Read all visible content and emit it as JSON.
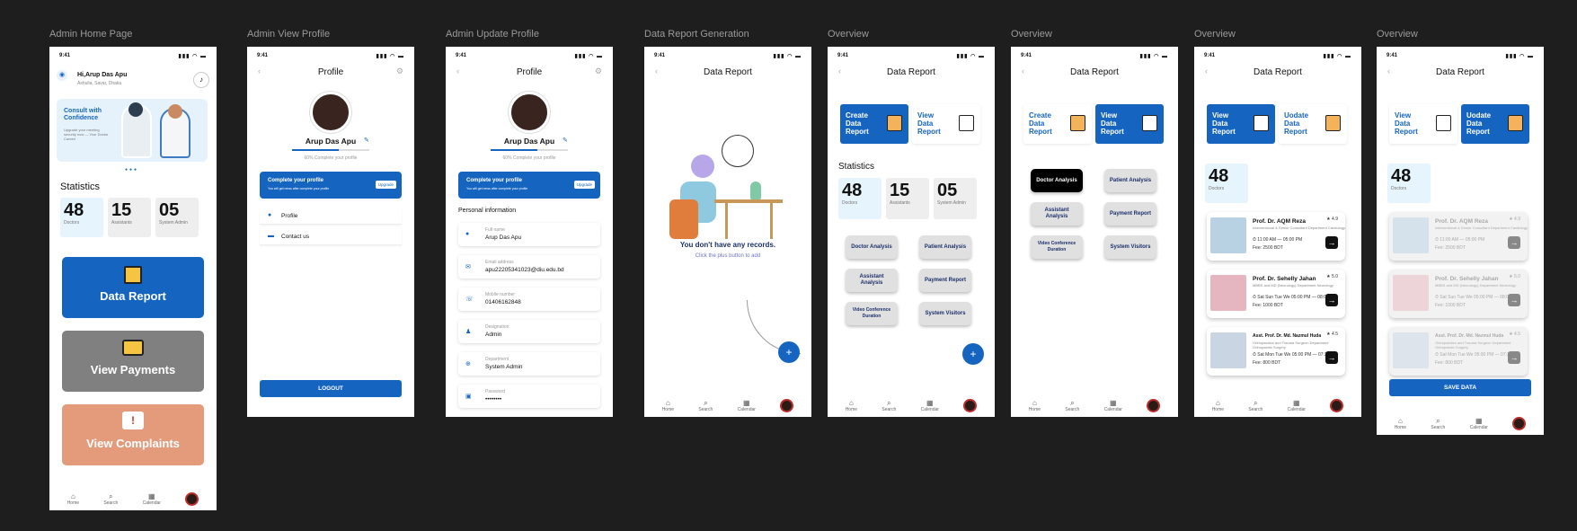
{
  "frames": [
    {
      "label": "Admin Home Page"
    },
    {
      "label": "Admin View Profile"
    },
    {
      "label": "Admin Update Profile"
    },
    {
      "label": "Data Report Generation"
    },
    {
      "label": "Overview"
    },
    {
      "label": "Overview"
    },
    {
      "label": "Overview"
    },
    {
      "label": "Overview"
    }
  ],
  "status_time": "9:41",
  "status_icons": "▮▮▮ ◠ ▬",
  "nav": {
    "home": "Home",
    "search": "Search",
    "calendar": "Calendar",
    "home_icon": "⌂",
    "search_icon": "⌕",
    "calendar_icon": "▦"
  },
  "home": {
    "greeting": "Hi,Arup Das Apu",
    "location": "Ashulia, Savar, Dhaka",
    "banner_title": "Consult with Confidence",
    "banner_text": "Upgrade your meeting security now — Your Doctor Career!",
    "statistics": "Statistics",
    "stats": [
      {
        "n": "48",
        "l": "Doctors"
      },
      {
        "n": "15",
        "l": "Assistants"
      },
      {
        "n": "05",
        "l": "System Admin"
      }
    ],
    "data_report": "Data Report",
    "view_payments": "View Payments",
    "view_complaints": "View Complaints"
  },
  "profile": {
    "title": "Profile",
    "name": "Arup Das Apu",
    "progress": 0.6,
    "progress_text": "60% Complete your profile",
    "complete_title": "Complete your profile",
    "complete_sub": "You will get news after complete your profile",
    "upgrade": "Upgrade",
    "menu_profile": "Profile",
    "menu_contact": "Contact us",
    "logout": "LOGOUT"
  },
  "update": {
    "section": "Personal information",
    "fields": [
      {
        "label": "Full name",
        "value": "Arup Das Apu"
      },
      {
        "label": "Email address",
        "value": "apu2220534102​3@diu.edu.bd"
      },
      {
        "label": "Mobile number",
        "value": "01406162848"
      },
      {
        "label": "Designation",
        "value": "Admin"
      },
      {
        "label": "Department",
        "value": "System Admin"
      },
      {
        "label": "Password",
        "value": "••••••••"
      }
    ]
  },
  "report": {
    "title": "Data Report",
    "empty_title": "You don't have any records.",
    "empty_sub": "Click the plus button to add",
    "create": "Create Data Report",
    "view": "View Data Report",
    "update": "Uodate Data Report",
    "statistics": "Statistics",
    "stats": [
      {
        "n": "48",
        "l": "Doctors"
      },
      {
        "n": "15",
        "l": "Assistants"
      },
      {
        "n": "05",
        "l": "System Admin"
      }
    ],
    "analysis": [
      "Doctor Analysis",
      "Patient Analysis",
      "Assistant Analysis",
      "Payment Report",
      "Video Conference Duration",
      "System Visitors"
    ],
    "save": "SAVE DATA"
  },
  "doctors": [
    {
      "name": "Prof. Dr. AQM Reza",
      "spec": "Interventional & Senior Consultant Department Cardiology",
      "time": "⏱ 11:00 AM — 05:00 PM",
      "fee": "Fee: 2500 BDT",
      "rating": "★ 4.9"
    },
    {
      "name": "Prof. Dr. Sehelly Jahan",
      "spec": "MBBS and MD (Neurology) Department Neurology",
      "time": "⏱ Sat Sun Tue We 05:00 PM — 08:00 PM",
      "fee": "Fee: 1000 BDT",
      "rating": "★ 5.0"
    },
    {
      "name": "Asst. Prof. Dr. Md. Nazmul Huda",
      "spec": "Orthopaedics and Trauma Surgeon Department Orthopaedic Surgery",
      "time": "⏱ Sat Mon Tue We 05:00 PM — 07:30 PM",
      "fee": "Fee: 800 BDT",
      "rating": "★ 4.5"
    }
  ],
  "colors": {
    "blue": "#1565c0",
    "gray": "#808080",
    "salmon": "#e39b7b",
    "black": "#000000"
  }
}
